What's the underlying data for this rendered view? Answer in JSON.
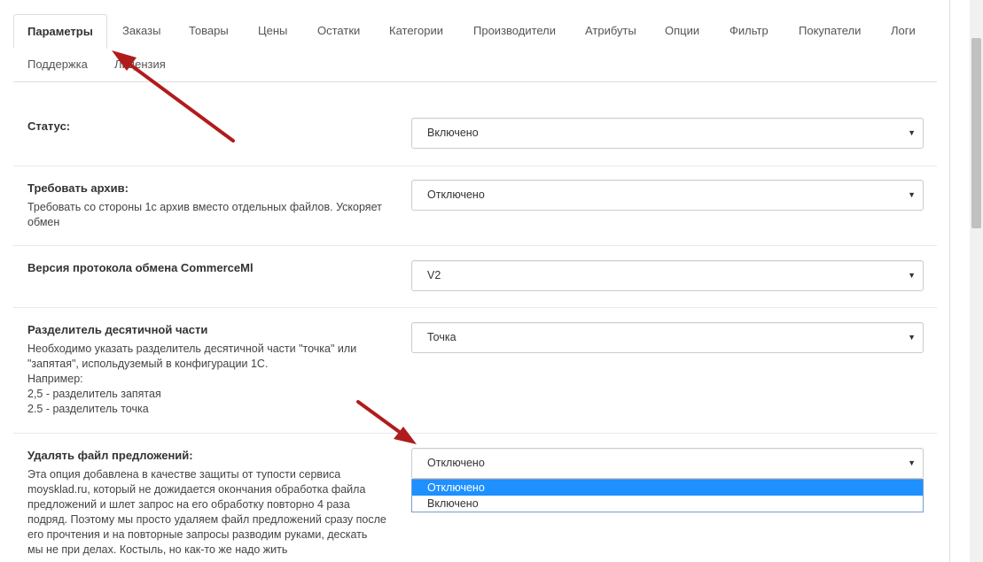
{
  "tabs": [
    {
      "label": "Параметры",
      "active": true
    },
    {
      "label": "Заказы"
    },
    {
      "label": "Товары"
    },
    {
      "label": "Цены"
    },
    {
      "label": "Остатки"
    },
    {
      "label": "Категории"
    },
    {
      "label": "Производители"
    },
    {
      "label": "Атрибуты"
    },
    {
      "label": "Опции"
    },
    {
      "label": "Фильтр"
    },
    {
      "label": "Покупатели"
    },
    {
      "label": "Логи"
    },
    {
      "label": "Поддержка"
    },
    {
      "label": "Лицензия"
    }
  ],
  "settings": {
    "status": {
      "label": "Статус:",
      "value": "Включено"
    },
    "require_archive": {
      "label": "Требовать архив:",
      "help": "Требовать со стороны 1с архив вместо отдельных файлов. Ускоряет обмен",
      "value": "Отключено"
    },
    "protocol": {
      "label": "Версия протокола обмена CommerceMl",
      "value": "V2"
    },
    "decimal": {
      "label": "Разделитель десятичной части",
      "help_lines": [
        "Необходимо указать разделитель десятичной части \"точка\" или",
        "\"запятая\", испольдуземый в конфигурации 1С.",
        "Например:",
        "2,5 - разделитель запятая",
        "2.5 - разделитель точка"
      ],
      "value": "Точка"
    },
    "delete_offers": {
      "label": "Удалять файл предложений:",
      "help_lines": [
        "Эта опция добавлена в качестве защиты от тупости сервиса",
        "moysklad.ru, который не дожидается окончания обработка файла",
        "предложений и шлет запрос на его обработку повторно 4 раза",
        "подряд. Поэтому мы просто удаляем файл предложений сразу после",
        "его прочтения и на повторные запросы разводим руками, дескать",
        "мы не при делах. Костыль, но как-то же надо жить"
      ],
      "value": "Отключено",
      "options": [
        "Отключено",
        "Включено"
      ],
      "highlighted_option": "Отключено"
    }
  },
  "icons": {
    "caret": "caret-down-icon"
  },
  "colors": {
    "annotation_arrow": "#b01c1c",
    "option_highlight": "#1e90ff"
  }
}
